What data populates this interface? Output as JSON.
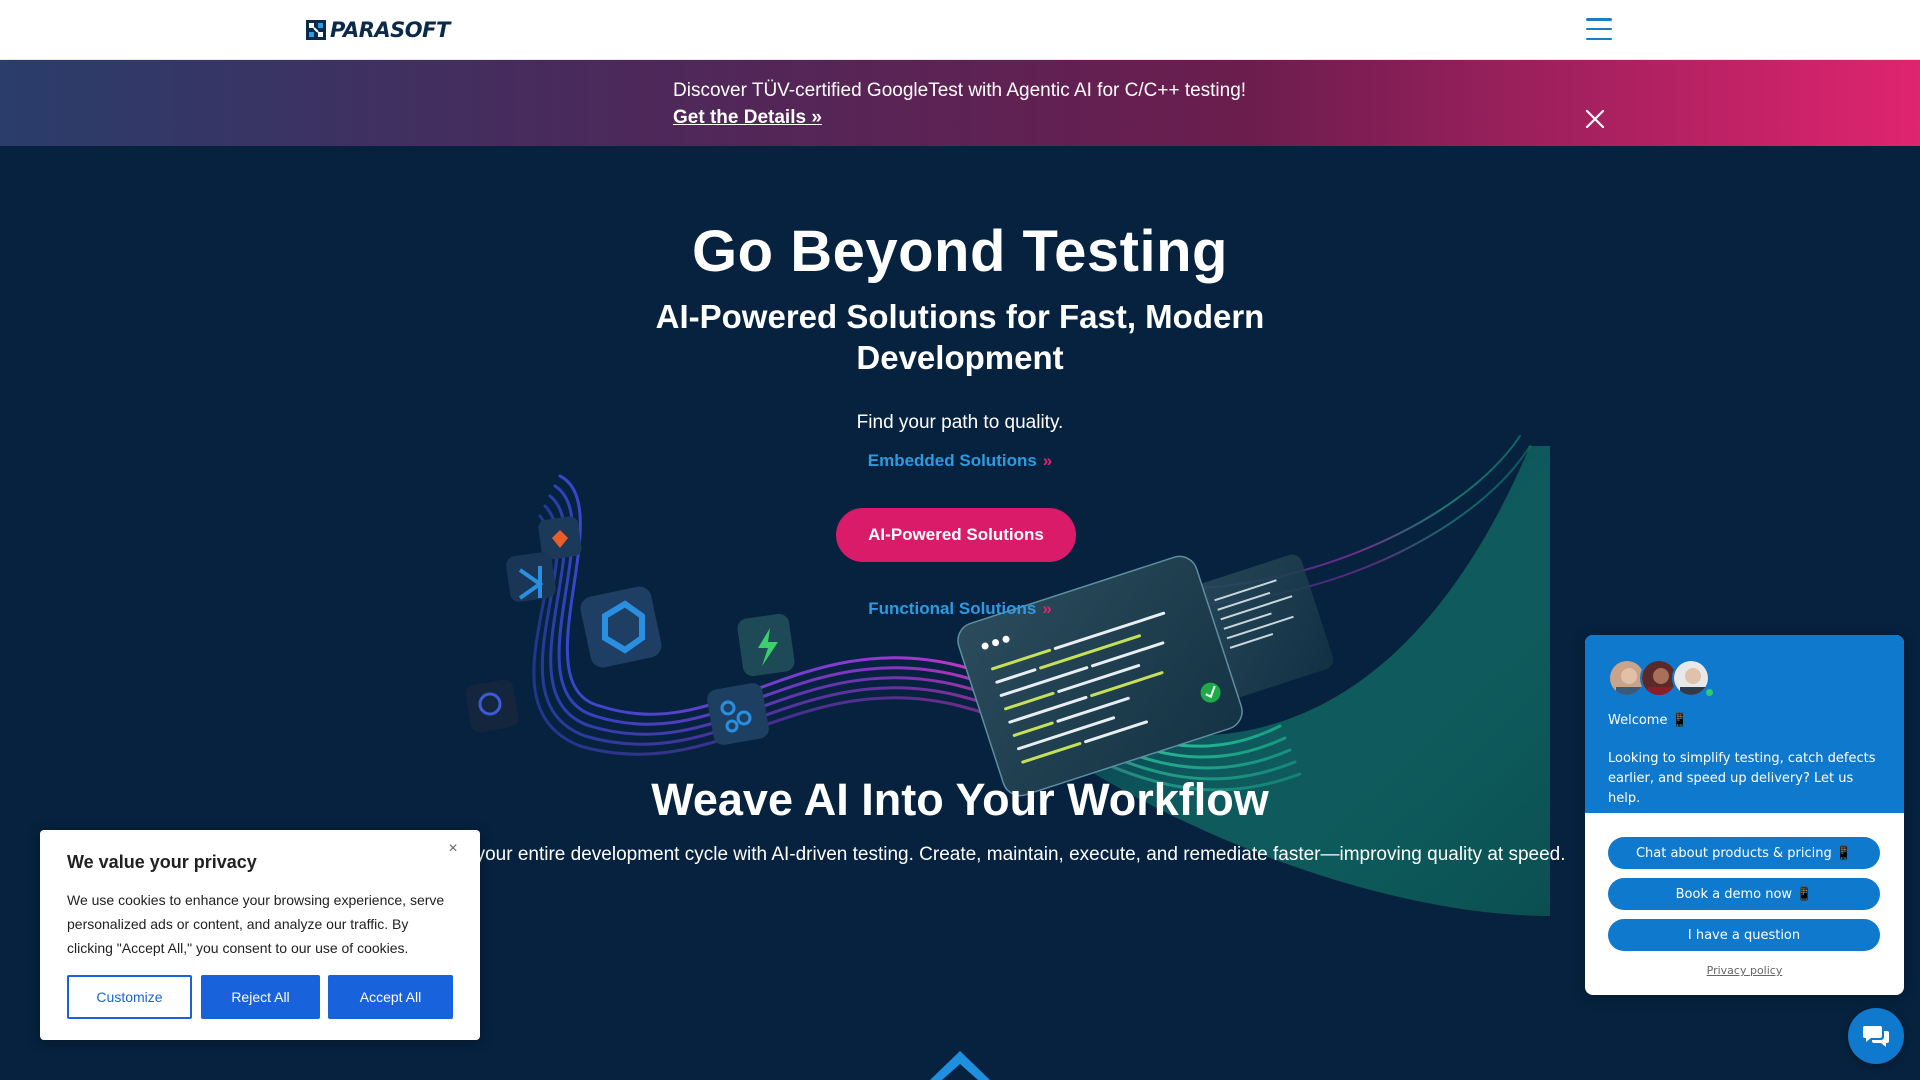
{
  "header": {
    "logo_text": "PARASOFT",
    "menu_icon": "hamburger-menu-icon"
  },
  "banner": {
    "text": "Discover TÜV-certified GoogleTest with Agentic AI for C/C++ testing!",
    "link": "Get the Details »",
    "close_icon": "close-icon"
  },
  "hero": {
    "title": "Go Beyond Testing",
    "subtitle": "AI-Powered Solutions for Fast, Modern Development",
    "tagline": "Find your path to quality.",
    "paths": [
      {
        "label": "Embedded Solutions",
        "chevron": "»"
      },
      {
        "label": "AI-Powered Solutions"
      },
      {
        "label": "Functional Solutions",
        "chevron": "»"
      }
    ],
    "weave_title": "Weave AI Into Your Workflow",
    "weave_text": "te your entire development cycle with AI-driven testing. Create, maintain, execute, and remediate faster—improving quality at speed."
  },
  "cookie": {
    "title": "We value your privacy",
    "body": "We use cookies to enhance your browsing experience, serve personalized ads or content, and analyze our traffic. By clicking \"Accept All,\" you consent to our use of cookies.",
    "close": "×",
    "buttons": {
      "customize": "Customize",
      "reject": "Reject All",
      "accept": "Accept All"
    },
    "colors": {
      "primary": "#1863dc"
    }
  },
  "chat": {
    "welcome": "Welcome 📱",
    "intro": "Looking to simplify testing, catch defects earlier, and speed up delivery? Let us help.",
    "options": [
      "Chat about products & pricing 📱",
      "Book a demo now 📱",
      "I have a question"
    ],
    "privacy": "Privacy policy",
    "colors": {
      "accent": "#0f79cd"
    }
  },
  "colors": {
    "page_bg": "#06223f",
    "brand_pink": "#d91b6a",
    "link_blue": "#2e9ae0"
  }
}
